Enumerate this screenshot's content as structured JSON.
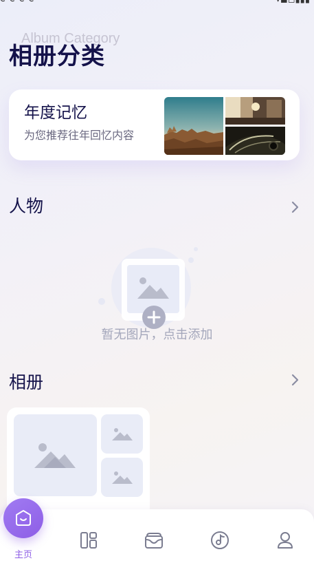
{
  "header": {
    "background_title": "Album Category",
    "title": "相册分类"
  },
  "memory_card": {
    "title": "年度记忆",
    "subtitle": "为您推荐往年回忆内容"
  },
  "people": {
    "title": "人物",
    "empty_text": "暂无图片，点击添加"
  },
  "albums": {
    "title": "相册"
  },
  "bottom_nav": {
    "items": [
      {
        "label": "主页",
        "icon": "home-icon",
        "active": true
      },
      {
        "label": "",
        "icon": "layout-icon",
        "active": false
      },
      {
        "label": "",
        "icon": "wallet-icon",
        "active": false
      },
      {
        "label": "",
        "icon": "music-icon",
        "active": false
      },
      {
        "label": "",
        "icon": "user-icon",
        "active": false
      }
    ]
  },
  "colors": {
    "accent": "#8e5ee6",
    "title": "#14124a",
    "placeholder": "#e9ecf7"
  }
}
